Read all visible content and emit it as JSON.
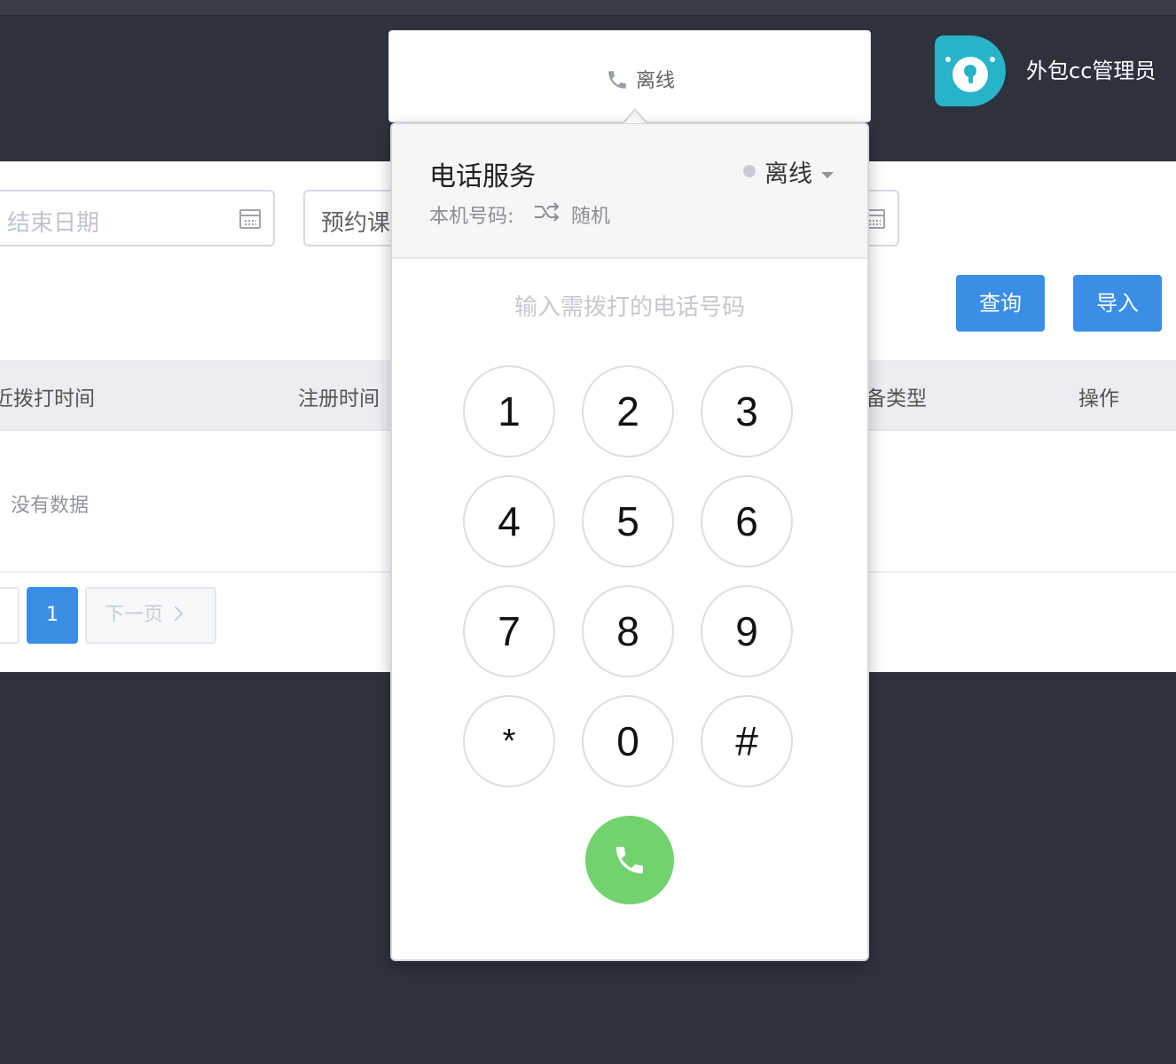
{
  "header": {
    "user_name": "外包cc管理员"
  },
  "filters": {
    "end_date_placeholder": "结束日期",
    "appointment_value": "预约课"
  },
  "actions": {
    "query_label": "查询",
    "import_label": "导入"
  },
  "table": {
    "columns": [
      "最近拨打时间",
      "注册时间",
      "设备类型",
      "操作"
    ],
    "visible_columns": [
      "近拨打时间",
      "注册时间",
      "备类型",
      "操作"
    ],
    "empty_text": "没有数据"
  },
  "pagination": {
    "current_page": "1",
    "next_label": "下一页"
  },
  "phone_trigger": {
    "status_label": "离线",
    "icon": "phone-icon"
  },
  "phone_panel": {
    "title": "电话服务",
    "status": "离线",
    "number_label": "本机号码:",
    "number_mode": "随机",
    "input_placeholder": "输入需拨打的电话号码",
    "keys": [
      "1",
      "2",
      "3",
      "4",
      "5",
      "6",
      "7",
      "8",
      "9",
      "*",
      "0",
      "#"
    ],
    "call_button_color": "#72d36e",
    "status_dot_color": "#c9ccd1"
  },
  "colors": {
    "primary": "#3a8ee6",
    "nav_background": "#2e323d",
    "avatar_accent": "#27b3c8"
  }
}
